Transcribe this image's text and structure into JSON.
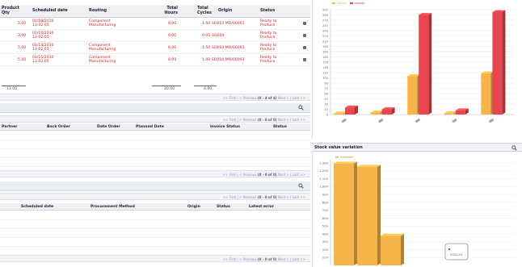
{
  "workorders": {
    "headers": {
      "product_qty": "Product Qty",
      "scheduled_date": "Scheduled date",
      "routing": "Routing",
      "total_hours": "Total Hours",
      "total_cycles": "Total Cycles",
      "origin": "Origin",
      "status": "Status"
    },
    "rows": [
      {
        "qty": "5.00",
        "date": "01/08/2010 13:02:05",
        "routing": "Component Manufacturing",
        "hours": "8.00",
        "cycles": "1.50",
        "origin": "SO003 MO/00001",
        "status": "Ready to Produce"
      },
      {
        "qty": "3.00",
        "date": "01/10/2010 13:02:05",
        "routing": "",
        "hours": "0.00",
        "cycles": "0.00",
        "origin": "SO004",
        "status": "Ready to Produce"
      },
      {
        "qty": "5.00",
        "date": "01/14/2010 13:02:05",
        "routing": "Component Manufacturing",
        "hours": "8.00",
        "cycles": "1.50",
        "origin": "SO003 MO/00001",
        "status": "Ready to Produce"
      },
      {
        "qty": "5.00",
        "date": "01/15/2010 13:02:05",
        "routing": "Component Manufacturing",
        "hours": "8.00",
        "cycles": "1.00",
        "origin": "SO004 MO/00003",
        "status": "Ready to Produce"
      }
    ],
    "totals": {
      "qty": "13.00",
      "hours": "20.00",
      "cycles": "4.00"
    }
  },
  "pager": {
    "first": "<< First",
    "previous": "< Previous",
    "range1": "(0 - 4 of 4)",
    "range0": "(0 - 0 of 0)",
    "next": "Next >",
    "last": "Last >>"
  },
  "invoices": {
    "headers": {
      "partner": "Partner",
      "back_order": "Back Order",
      "date_order": "Date Order",
      "planned_date": "Planned Date",
      "invoice_status": "Invoice Status",
      "status": "Status"
    }
  },
  "procurements": {
    "headers": {
      "scheduled_date": "Scheduled date",
      "method": "Procurement Method",
      "origin": "Origin",
      "status": "Status",
      "latest_error": "Latest error"
    }
  },
  "icons": {
    "search": "search-icon",
    "row_action": "edit-icon"
  },
  "chart_data": [
    {
      "type": "bar",
      "title": "",
      "series": [
        {
          "name": "",
          "color": "#f5b54a",
          "values": [
            3,
            6,
            110,
            4,
            118
          ]
        },
        {
          "name": "",
          "color": "#e8474f",
          "values": [
            20,
            15,
            285,
            12,
            293
          ]
        }
      ],
      "categories": [
        "",
        "",
        "",
        "",
        ""
      ],
      "ylim": [
        0,
        300
      ],
      "yticks": [
        "0",
        "15",
        "30",
        "45",
        "60",
        "75",
        "90",
        "105",
        "120",
        "135",
        "150",
        "165",
        "180",
        "195",
        "210",
        "225",
        "240",
        "255",
        "270",
        "285",
        "300"
      ],
      "grid": true,
      "legend": "top-left"
    },
    {
      "type": "bar",
      "title": "Stock value variation",
      "series": [
        {
          "name": "",
          "color": "#f5b54a",
          "values": [
            1290,
            1250,
            375
          ]
        }
      ],
      "categories": [
        "",
        "",
        ""
      ],
      "ylim": [
        0,
        1350
      ],
      "yticks": [
        "100",
        "200",
        "300",
        "400",
        "500",
        "600",
        "700",
        "800",
        "900",
        "1,000",
        "1,100",
        "1,200",
        "1,300"
      ],
      "grid": true,
      "legend": "top-left",
      "tooltip": "2010-01"
    }
  ]
}
